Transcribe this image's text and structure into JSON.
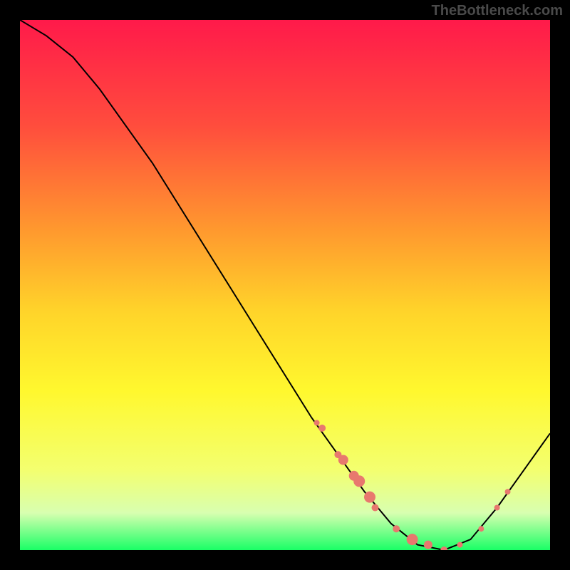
{
  "watermark": "TheBottleneck.com",
  "chart_data": {
    "type": "line",
    "title": "",
    "xlabel": "",
    "ylabel": "",
    "xlim": [
      0,
      100
    ],
    "ylim": [
      0,
      100
    ],
    "curve": [
      {
        "x": 0,
        "y": 100
      },
      {
        "x": 5,
        "y": 97
      },
      {
        "x": 10,
        "y": 93
      },
      {
        "x": 15,
        "y": 87
      },
      {
        "x": 20,
        "y": 80
      },
      {
        "x": 25,
        "y": 73
      },
      {
        "x": 30,
        "y": 65
      },
      {
        "x": 35,
        "y": 57
      },
      {
        "x": 40,
        "y": 49
      },
      {
        "x": 45,
        "y": 41
      },
      {
        "x": 50,
        "y": 33
      },
      {
        "x": 55,
        "y": 25
      },
      {
        "x": 60,
        "y": 18
      },
      {
        "x": 65,
        "y": 11
      },
      {
        "x": 70,
        "y": 5
      },
      {
        "x": 75,
        "y": 1
      },
      {
        "x": 80,
        "y": 0
      },
      {
        "x": 85,
        "y": 2
      },
      {
        "x": 90,
        "y": 8
      },
      {
        "x": 95,
        "y": 15
      },
      {
        "x": 100,
        "y": 22
      }
    ],
    "markers": [
      {
        "x": 56,
        "y": 24,
        "r": 4
      },
      {
        "x": 57,
        "y": 23,
        "r": 5
      },
      {
        "x": 60,
        "y": 18,
        "r": 5
      },
      {
        "x": 61,
        "y": 17,
        "r": 7
      },
      {
        "x": 63,
        "y": 14,
        "r": 7
      },
      {
        "x": 64,
        "y": 13,
        "r": 8
      },
      {
        "x": 66,
        "y": 10,
        "r": 8
      },
      {
        "x": 67,
        "y": 8,
        "r": 5
      },
      {
        "x": 71,
        "y": 4,
        "r": 5
      },
      {
        "x": 74,
        "y": 2,
        "r": 8
      },
      {
        "x": 77,
        "y": 1,
        "r": 6
      },
      {
        "x": 80,
        "y": 0,
        "r": 5
      },
      {
        "x": 83,
        "y": 1,
        "r": 4
      },
      {
        "x": 87,
        "y": 4,
        "r": 4
      },
      {
        "x": 90,
        "y": 8,
        "r": 4
      },
      {
        "x": 92,
        "y": 11,
        "r": 4
      }
    ],
    "gradient_stops": [
      {
        "offset": 0,
        "color": "#ff1a4a"
      },
      {
        "offset": 20,
        "color": "#ff4d3d"
      },
      {
        "offset": 40,
        "color": "#ff9a2e"
      },
      {
        "offset": 55,
        "color": "#ffd42a"
      },
      {
        "offset": 70,
        "color": "#fff82e"
      },
      {
        "offset": 85,
        "color": "#f3ff70"
      },
      {
        "offset": 93,
        "color": "#d8ffb0"
      },
      {
        "offset": 100,
        "color": "#1aff66"
      }
    ],
    "marker_color": "#e8786e",
    "curve_color": "#000000"
  }
}
